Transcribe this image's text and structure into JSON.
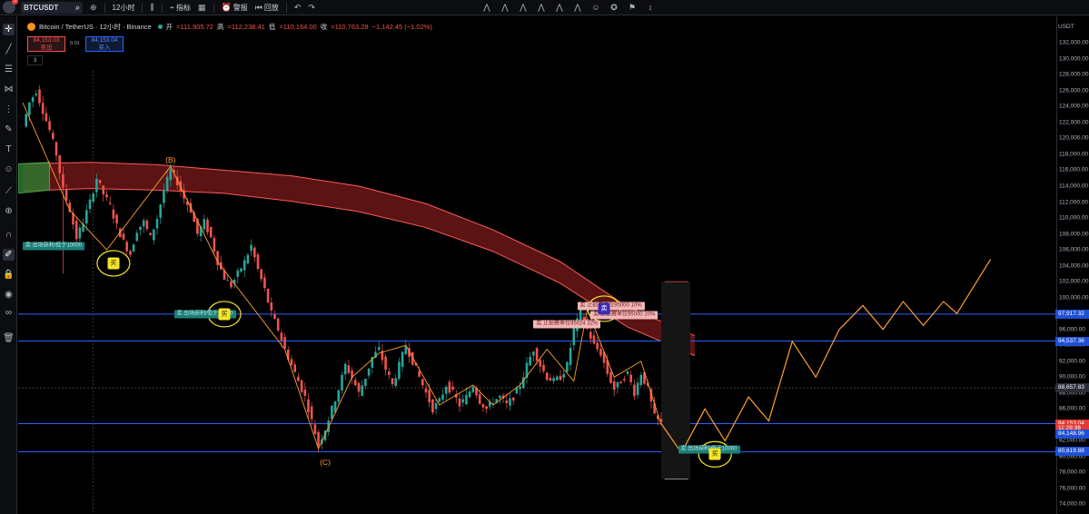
{
  "toolbar": {
    "notification_count": "3",
    "symbol": "BTCUSDT",
    "interval": "12小时",
    "indicators_label": "指标",
    "alert_label": "警报",
    "replay_label": "回放"
  },
  "legend": {
    "title": "Bitcoin / TetherUS · 12小时 · Binance",
    "open_label": "开",
    "open_value": "=111,905.72",
    "high_label": "高",
    "high_value": "=112,238.41",
    "low_label": "低",
    "low_value": "=110,164.00",
    "close_label": "收",
    "close_value": "=110,763.28",
    "change": "−1,142.45 (−1.02%)"
  },
  "trade": {
    "sell_price": "84,153.03",
    "sell_label": "卖出",
    "spread": "0.01",
    "buy_price": "84,153.04",
    "buy_label": "买入",
    "indicator_count": "3"
  },
  "axis": {
    "unit": "USDT"
  },
  "price_labels": [
    {
      "text": "97,917.32",
      "price": 97917.32,
      "color": "#1e4fd6"
    },
    {
      "text": "94,537.36",
      "price": 94537.36,
      "color": "#1e4fd6"
    },
    {
      "text": "88,657.83",
      "price": 88657.83,
      "color": "#2a2e39"
    },
    {
      "text": "84,153.04",
      "price": 84153.04,
      "color": "#e53935"
    },
    {
      "text": "11:29:38",
      "price": 83500,
      "color": "#e53935"
    },
    {
      "text": "84,148.96",
      "price": 82850,
      "color": "#1e4fd6"
    },
    {
      "text": "80,619.88",
      "price": 80619.88,
      "color": "#1e4fd6"
    }
  ],
  "chart_data": {
    "type": "candlestick",
    "title": "Bitcoin / TetherUS · 12小时 · Binance",
    "ylim": [
      72800,
      134200
    ],
    "yticks": [
      74000,
      76000,
      78000,
      80000,
      82000,
      84000,
      86000,
      88000,
      90000,
      92000,
      94000,
      96000,
      98000,
      100000,
      102000,
      104000,
      106000,
      108000,
      110000,
      112000,
      114000,
      116000,
      118000,
      120000,
      122000,
      124000,
      126000,
      128000,
      130000,
      132000
    ],
    "ytick_labels": [
      "74,000.00",
      "76,000.00",
      "78,000.00",
      "80,000.00",
      "82,000.00",
      "84,000.00",
      "86,000.00",
      "88,000.00",
      "90,000.00",
      "92,000.00",
      "94,000.00",
      "96,000.00",
      "98,000.00",
      "100,000.00",
      "102,000.00",
      "104,000.00",
      "106,000.00",
      "108,000.00",
      "110,000.00",
      "112,000.00",
      "114,000.00",
      "116,000.00",
      "118,000.00",
      "120,000.00",
      "122,000.00",
      "124,000.00",
      "126,000.00",
      "128,000.00",
      "130,000.00",
      "132,000.00"
    ],
    "horizontal_levels": [
      97917.32,
      94537.36,
      84153.04,
      80619.88
    ],
    "close_path": [
      [
        0,
        121500
      ],
      [
        2,
        124500
      ],
      [
        4,
        126000
      ],
      [
        6,
        123500
      ],
      [
        8,
        121000
      ],
      [
        10,
        118000
      ],
      [
        12,
        113500
      ],
      [
        14,
        111000
      ],
      [
        16,
        107500
      ],
      [
        18,
        109500
      ],
      [
        20,
        112000
      ],
      [
        22,
        115000
      ],
      [
        24,
        113000
      ],
      [
        26,
        111500
      ],
      [
        28,
        109000
      ],
      [
        30,
        107000
      ],
      [
        32,
        105500
      ],
      [
        34,
        108500
      ],
      [
        36,
        109500
      ],
      [
        38,
        107500
      ],
      [
        40,
        110000
      ],
      [
        42,
        113500
      ],
      [
        44,
        116000
      ],
      [
        46,
        114500
      ],
      [
        48,
        112500
      ],
      [
        50,
        111000
      ],
      [
        52,
        108000
      ],
      [
        54,
        109500
      ],
      [
        56,
        107500
      ],
      [
        58,
        104500
      ],
      [
        60,
        102500
      ],
      [
        62,
        101500
      ],
      [
        64,
        103000
      ],
      [
        66,
        104500
      ],
      [
        68,
        106500
      ],
      [
        70,
        103500
      ],
      [
        72,
        101000
      ],
      [
        74,
        98000
      ],
      [
        76,
        96000
      ],
      [
        78,
        93500
      ],
      [
        80,
        91500
      ],
      [
        82,
        89500
      ],
      [
        84,
        87500
      ],
      [
        86,
        84500
      ],
      [
        88,
        81500
      ],
      [
        90,
        83500
      ],
      [
        92,
        86000
      ],
      [
        94,
        88500
      ],
      [
        96,
        91500
      ],
      [
        98,
        90000
      ],
      [
        100,
        88000
      ],
      [
        102,
        90000
      ],
      [
        104,
        92500
      ],
      [
        106,
        93500
      ],
      [
        108,
        91000
      ],
      [
        110,
        89000
      ],
      [
        112,
        91500
      ],
      [
        114,
        94000
      ],
      [
        116,
        92000
      ],
      [
        118,
        90000
      ],
      [
        120,
        88000
      ],
      [
        122,
        86000
      ],
      [
        124,
        87000
      ],
      [
        126,
        89000
      ],
      [
        128,
        88000
      ],
      [
        130,
        86500
      ],
      [
        132,
        87500
      ],
      [
        134,
        89000
      ],
      [
        136,
        87000
      ],
      [
        138,
        86000
      ],
      [
        140,
        87000
      ],
      [
        142,
        87500
      ],
      [
        144,
        86500
      ],
      [
        146,
        87500
      ],
      [
        148,
        89000
      ],
      [
        150,
        91500
      ],
      [
        152,
        93500
      ],
      [
        154,
        91500
      ],
      [
        156,
        90000
      ],
      [
        158,
        89500
      ],
      [
        160,
        90000
      ],
      [
        162,
        91500
      ],
      [
        164,
        96000
      ],
      [
        166,
        98000
      ],
      [
        168,
        96000
      ],
      [
        170,
        94000
      ],
      [
        172,
        93000
      ],
      [
        174,
        90500
      ],
      [
        176,
        88500
      ],
      [
        178,
        89500
      ],
      [
        180,
        90500
      ],
      [
        182,
        88000
      ],
      [
        184,
        90500
      ],
      [
        186,
        88500
      ],
      [
        188,
        85000
      ],
      [
        190,
        84153
      ]
    ],
    "wave_labels": [
      {
        "text": "(B)",
        "x": 44,
        "price": 117300
      },
      {
        "text": "(C)",
        "x": 90,
        "price": 79300
      }
    ],
    "forecast_path": [
      [
        190,
        84153
      ],
      [
        196,
        80500
      ],
      [
        203,
        86000
      ],
      [
        209,
        82000
      ],
      [
        216,
        87500
      ],
      [
        222,
        84500
      ],
      [
        229,
        94500
      ],
      [
        236,
        90000
      ],
      [
        243,
        96000
      ],
      [
        250,
        99000
      ],
      [
        256,
        96000
      ],
      [
        262,
        99500
      ],
      [
        268,
        96500
      ],
      [
        274,
        99500
      ],
      [
        278,
        98000
      ],
      [
        288,
        104800
      ]
    ],
    "zigzag_path": [
      [
        0,
        124500
      ],
      [
        14,
        111000
      ],
      [
        25,
        106000
      ],
      [
        44,
        116500
      ],
      [
        58,
        104500
      ],
      [
        78,
        93500
      ],
      [
        88,
        81000
      ],
      [
        98,
        90000
      ],
      [
        106,
        93000
      ],
      [
        114,
        94000
      ],
      [
        124,
        86500
      ],
      [
        134,
        89000
      ],
      [
        140,
        86500
      ],
      [
        148,
        89000
      ],
      [
        156,
        93500
      ],
      [
        164,
        89500
      ],
      [
        168,
        98500
      ],
      [
        176,
        90000
      ],
      [
        184,
        92000
      ],
      [
        190,
        84000
      ]
    ],
    "cloud_upper": [
      [
        0,
        116800
      ],
      [
        20,
        117000
      ],
      [
        40,
        116700
      ],
      [
        60,
        116000
      ],
      [
        80,
        115300
      ],
      [
        100,
        114000
      ],
      [
        120,
        111800
      ],
      [
        140,
        108500
      ],
      [
        160,
        104500
      ],
      [
        180,
        98800
      ],
      [
        200,
        95200
      ]
    ],
    "cloud_lower": [
      [
        0,
        113400
      ],
      [
        20,
        113700
      ],
      [
        40,
        113500
      ],
      [
        60,
        113100
      ],
      [
        80,
        112100
      ],
      [
        100,
        110800
      ],
      [
        120,
        108800
      ],
      [
        140,
        105800
      ],
      [
        160,
        101800
      ],
      [
        180,
        96300
      ],
      [
        200,
        92700
      ]
    ],
    "annotations": [
      {
        "text": "卖 出场获利/低于10000",
        "x": 0,
        "price": 106500,
        "kind": "teal"
      },
      {
        "text": "卖 出场获利/低于10000",
        "x": 45,
        "price": 97917.32,
        "kind": "teal"
      },
      {
        "text": "卖 止损赛单位95000 10%",
        "x": 165,
        "price": 98900,
        "kind": "pink"
      },
      {
        "text": "卖 止损赛单位95000 20%",
        "x": 169,
        "price": 97800,
        "kind": "pink"
      },
      {
        "text": "卖 止损赛单位95024 32%",
        "x": 152,
        "price": 96600,
        "kind": "pink"
      },
      {
        "text": "卖 出场获利/低于10000",
        "x": 195,
        "price": 80900,
        "kind": "teal"
      }
    ],
    "trade_marks": [
      {
        "text": "买",
        "x": 27,
        "price": 104300,
        "style": "yellow"
      },
      {
        "text": "买",
        "x": 60,
        "price": 97917,
        "style": "yellow"
      },
      {
        "text": "卖",
        "x": 173,
        "price": 98600,
        "style": "purple"
      },
      {
        "text": "买",
        "x": 206,
        "price": 80300,
        "style": "yellow"
      }
    ]
  }
}
